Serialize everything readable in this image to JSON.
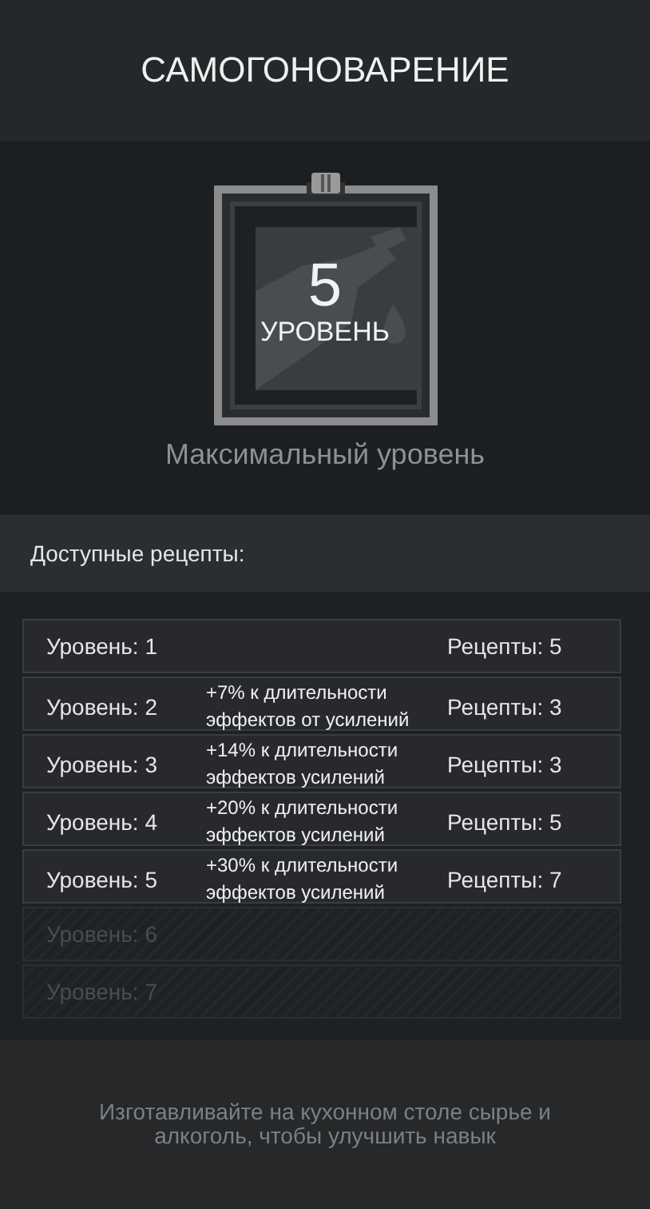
{
  "title": "САМОГОНОВАРЕНИЕ",
  "skill": {
    "level": "5",
    "level_label": "УРОВЕНЬ",
    "status": "Максимальный уровень"
  },
  "recipes_heading": "Доступные рецепты:",
  "levels": [
    {
      "label": "Уровень: 1",
      "recipes": "Рецепты: 5",
      "unlocked": true
    },
    {
      "label": "Уровень: 2",
      "bonus": "+7% к длительности эффектов от усилений",
      "recipes": "Рецепты: 3",
      "unlocked": true
    },
    {
      "label": "Уровень: 3",
      "bonus": "+14% к длительности эффектов усилений",
      "recipes": "Рецепты: 3",
      "unlocked": true
    },
    {
      "label": "Уровень: 4",
      "bonus": "+20% к длительности эффектов усилений",
      "recipes": "Рецепты: 5",
      "unlocked": true
    },
    {
      "label": "Уровень: 5",
      "bonus": "+30% к длительности эффектов усилений",
      "recipes": "Рецепты: 7",
      "unlocked": true
    },
    {
      "label": "Уровень: 6",
      "unlocked": false
    },
    {
      "label": "Уровень: 7",
      "unlocked": false
    }
  ],
  "hint": "Изготавливайте на кухонном столе сырье и алкоголь, чтобы улучшить навык"
}
